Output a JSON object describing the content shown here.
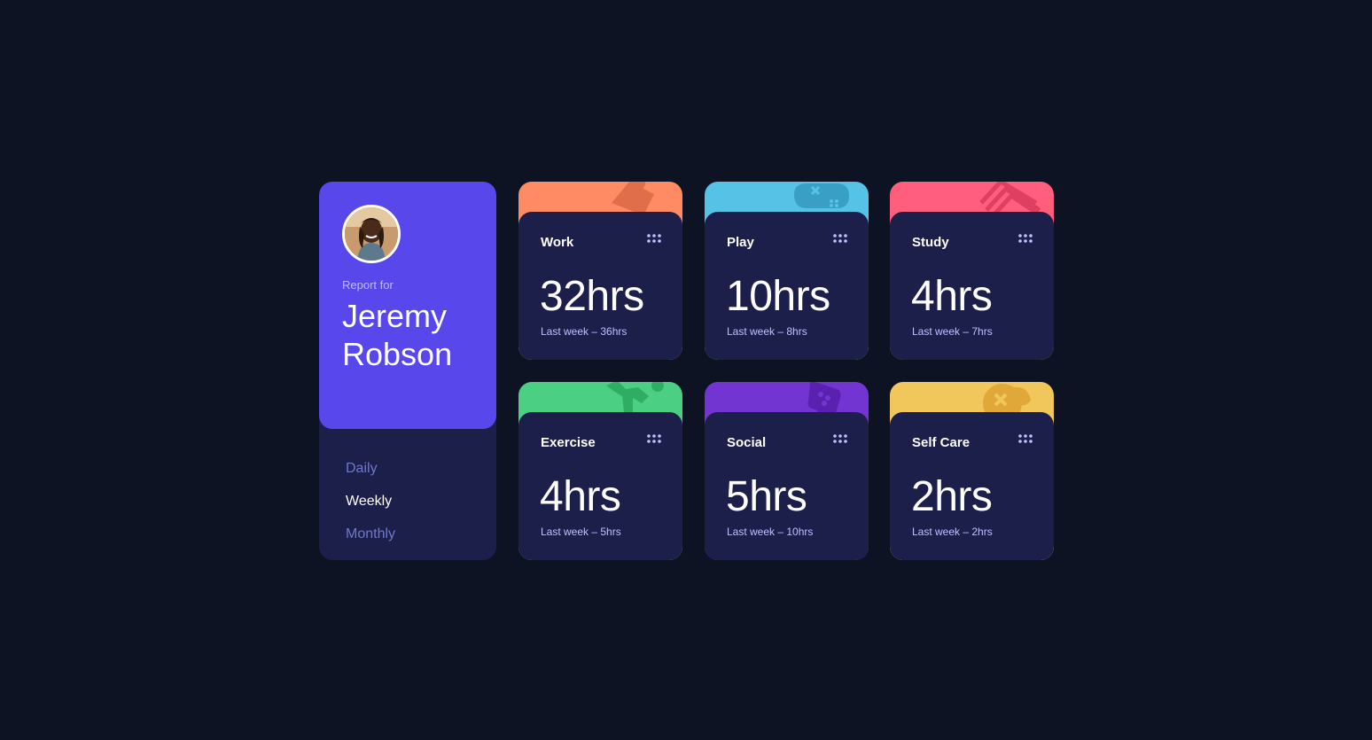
{
  "profile": {
    "report_label": "Report for",
    "name": "Jeremy Robson"
  },
  "periods": [
    {
      "label": "Daily",
      "active": false
    },
    {
      "label": "Weekly",
      "active": true
    },
    {
      "label": "Monthly",
      "active": false
    }
  ],
  "activities": [
    {
      "title": "Work",
      "current": "32hrs",
      "previous": "Last week – 36hrs",
      "color": "#ff8b64",
      "icon": "briefcase-icon"
    },
    {
      "title": "Play",
      "current": "10hrs",
      "previous": "Last week – 8hrs",
      "color": "#55c2e6",
      "icon": "gamepad-icon"
    },
    {
      "title": "Study",
      "current": "4hrs",
      "previous": "Last week – 7hrs",
      "color": "#ff5e7d",
      "icon": "books-icon"
    },
    {
      "title": "Exercise",
      "current": "4hrs",
      "previous": "Last week – 5hrs",
      "color": "#4bcf82",
      "icon": "runner-icon"
    },
    {
      "title": "Social",
      "current": "5hrs",
      "previous": "Last week – 10hrs",
      "color": "#7335d2",
      "icon": "chat-icon"
    },
    {
      "title": "Self Care",
      "current": "2hrs",
      "previous": "Last week – 2hrs",
      "color": "#f1c75b",
      "icon": "heart-icon"
    }
  ],
  "colors": {
    "background": "#0e1323",
    "card": "#1c1f4a",
    "accent": "#5847eb",
    "muted_text": "#bdc1ff",
    "inactive_period": "#7078c9"
  }
}
